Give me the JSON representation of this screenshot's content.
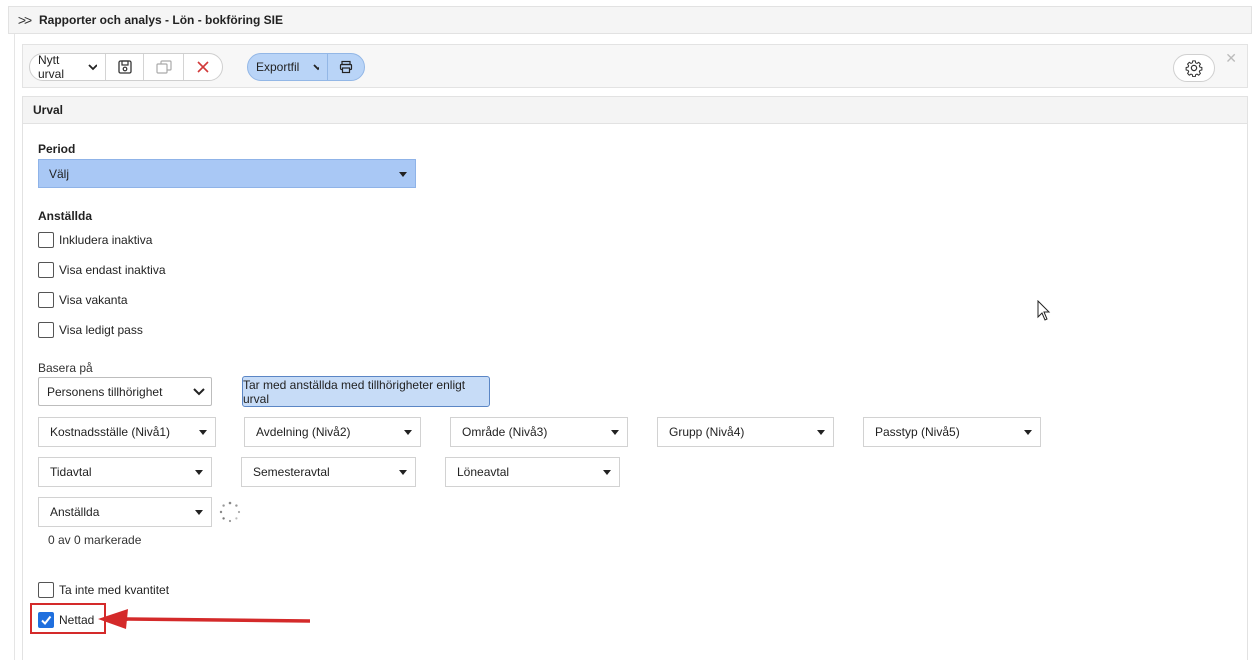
{
  "header": {
    "expand_icon": "double-chevron-right-icon",
    "title": "Rapporter och analys - Lön - bokföring SIE"
  },
  "toolbar": {
    "selection_label": "Nytt urval",
    "save_icon": "save-icon",
    "copy_icon": "copy-icon",
    "delete_icon": "delete-x-icon",
    "export_label": "Exportfil",
    "print_icon": "print-icon",
    "settings_icon": "gear-icon",
    "close_icon": "close-icon"
  },
  "urval": {
    "title": "Urval",
    "period": {
      "label": "Period",
      "value": "Välj"
    },
    "employees": {
      "label": "Anställda",
      "checkboxes": [
        {
          "label": "Inkludera inaktiva",
          "checked": false
        },
        {
          "label": "Visa endast inaktiva",
          "checked": false
        },
        {
          "label": "Visa vakanta",
          "checked": false
        },
        {
          "label": "Visa ledigt pass",
          "checked": false
        }
      ]
    },
    "base_on": {
      "label": "Basera på",
      "value": "Personens tillhörighet",
      "info_button": "Tar med anställda med tillhörigheter enligt urval"
    },
    "filters_row1": [
      "Kostnadsställe (Nivå1)",
      "Avdelning (Nivå2)",
      "Område (Nivå3)",
      "Grupp (Nivå4)",
      "Passtyp (Nivå5)"
    ],
    "filters_row2": [
      "Tidavtal",
      "Semesteravtal",
      "Löneavtal"
    ],
    "employees_dropdown": "Anställda",
    "selected_count": "0 av 0 markerade",
    "options": [
      {
        "label": "Ta inte med kvantitet",
        "checked": false
      },
      {
        "label": "Nettad",
        "checked": true
      }
    ]
  },
  "colors": {
    "accent_blue": "#a9c8f5",
    "checkbox_blue": "#1f6fde",
    "annotation_red": "#d42a2a"
  }
}
